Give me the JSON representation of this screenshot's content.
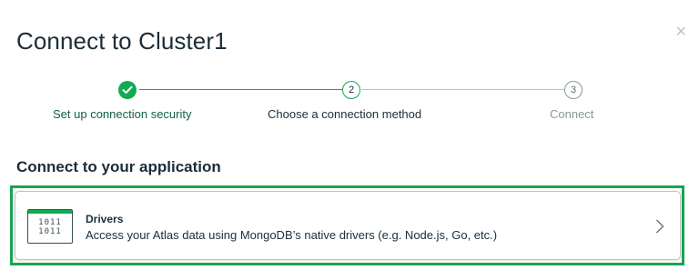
{
  "modal": {
    "title": "Connect to Cluster1",
    "close_glyph": "×"
  },
  "stepper": {
    "steps": [
      {
        "number": "1",
        "label": "Set up connection security",
        "state": "complete"
      },
      {
        "number": "2",
        "label": "Choose a connection method",
        "state": "active"
      },
      {
        "number": "3",
        "label": "Connect",
        "state": "pending"
      }
    ]
  },
  "section": {
    "heading": "Connect to your application"
  },
  "options": [
    {
      "title": "Drivers",
      "description": "Access your Atlas data using MongoDB’s native drivers (e.g. Node.js, Go, etc.)",
      "icon": "binary-code-icon",
      "icon_text_line1": "1011",
      "icon_text_line2": "1011"
    }
  ],
  "colors": {
    "accent": "#13aa52",
    "highlight_border": "#1aa351",
    "text_dark": "#1c2d38",
    "step_complete_text": "#116149",
    "muted": "#89979b"
  }
}
